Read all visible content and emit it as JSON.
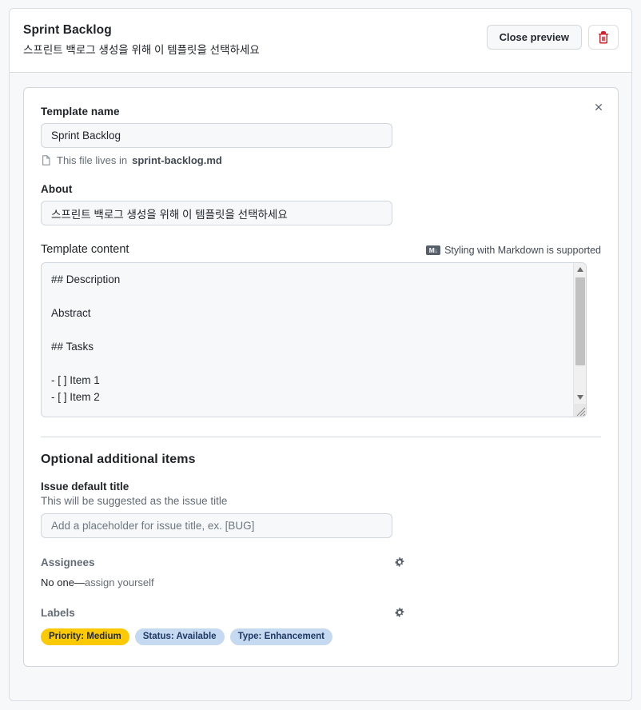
{
  "header": {
    "title": "Sprint Backlog",
    "subtitle": "스프린트 백로그 생성을 위해 이 템플릿을 선택하세요",
    "close_preview_label": "Close preview",
    "delete_icon": "trash-icon"
  },
  "form": {
    "template_name_label": "Template name",
    "template_name_value": "Sprint Backlog",
    "file_note_prefix": "This file lives in",
    "file_note_filename": "sprint-backlog.md",
    "about_label": "About",
    "about_value": "스프린트 백로그 생성을 위해 이 템플릿을 선택하세요",
    "content_label": "Template content",
    "markdown_note": "Styling with Markdown is supported",
    "markdown_badge": "M↓",
    "content_value": "## Description\n\nAbstract\n\n## Tasks\n\n- [ ] Item 1\n- [ ] Item 2"
  },
  "optional": {
    "section_title": "Optional additional items",
    "issue_title_label": "Issue default title",
    "issue_title_hint": "This will be suggested as the issue title",
    "issue_title_placeholder": "Add a placeholder for issue title, ex. [BUG]",
    "issue_title_value": "",
    "assignees_label": "Assignees",
    "assignees_value_prefix": "No one—",
    "assignees_value_link": "assign yourself",
    "labels_label": "Labels",
    "labels": [
      {
        "text": "Priority: Medium",
        "bg": "#fbca04",
        "fg": "#24292f"
      },
      {
        "text": "Status: Available",
        "bg": "#c5d9f0",
        "fg": "#1f3864"
      },
      {
        "text": "Type: Enhancement",
        "bg": "#c5d9f0",
        "fg": "#1f3864"
      }
    ]
  },
  "colors": {
    "page_bg": "#f6f8fa",
    "card_bg": "#ffffff",
    "border": "#d0d7de",
    "danger": "#cf222e",
    "text": "#1f2328",
    "muted": "#636c76"
  }
}
